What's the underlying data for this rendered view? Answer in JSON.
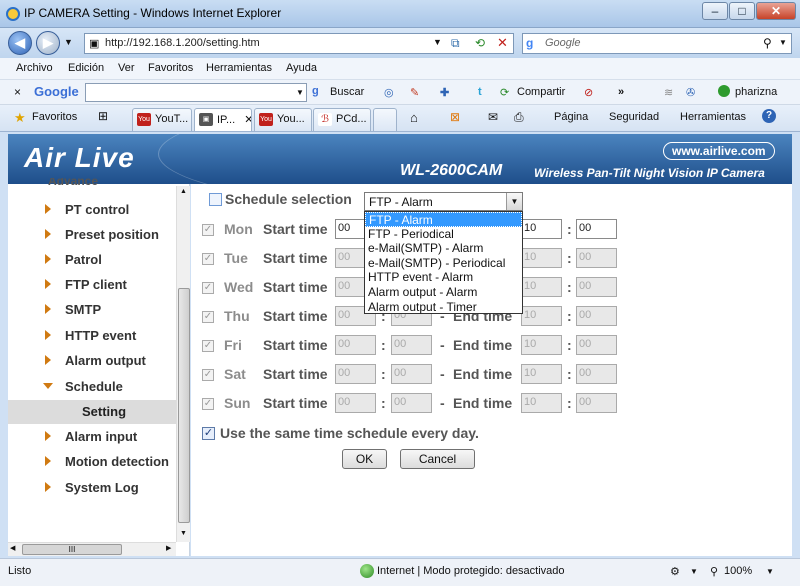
{
  "window": {
    "title": "IP CAMERA Setting - Windows Internet Explorer",
    "minimize": "–",
    "maximize": "□",
    "close": "✕"
  },
  "address_bar": {
    "url": "http://192.168.1.200/setting.htm",
    "search_placeholder": "Google"
  },
  "menu": [
    "Archivo",
    "Edición",
    "Ver",
    "Favoritos",
    "Herramientas",
    "Ayuda"
  ],
  "google_toolbar": {
    "label": "Google",
    "buscar": "Buscar",
    "compartir": "Compartir",
    "user": "pharizna"
  },
  "favorites_bar": {
    "favorites": "Favoritos",
    "tabs": [
      "YouT...",
      "IP...",
      "You...",
      "PCd..."
    ],
    "pagina": "Página",
    "seguridad": "Seguridad",
    "herramientas": "Herramientas"
  },
  "banner": {
    "logo": "Air Live",
    "website": "www.airlive.com",
    "model": "WL-2600CAM",
    "description": "Wireless Pan-Tilt Night Vision IP Camera"
  },
  "sidebar": {
    "partial_top": "Advance",
    "items": [
      {
        "label": "PT control"
      },
      {
        "label": "Preset position"
      },
      {
        "label": "Patrol"
      },
      {
        "label": "FTP client"
      },
      {
        "label": "SMTP"
      },
      {
        "label": "HTTP event"
      },
      {
        "label": "Alarm output"
      },
      {
        "label": "Schedule"
      },
      {
        "label": "Setting"
      },
      {
        "label": "Alarm input"
      },
      {
        "label": "Motion detection"
      },
      {
        "label": "System Log"
      }
    ],
    "hscroll_grip": "III"
  },
  "schedule": {
    "selection_label": "Schedule selection",
    "selected": "FTP - Alarm",
    "options": [
      "FTP - Alarm",
      "FTP - Periodical",
      "e-Mail(SMTP) - Alarm",
      "e-Mail(SMTP) - Periodical",
      "HTTP event - Alarm",
      "Alarm output - Alarm",
      "Alarm output - Timer"
    ],
    "start_label": "Start time",
    "end_label": "End time",
    "days": [
      {
        "day": "Mon",
        "start_h": "00",
        "start_m": "00",
        "end_h": "10",
        "end_m": "00"
      },
      {
        "day": "Tue",
        "start_h": "00",
        "start_m": "00",
        "end_h": "10",
        "end_m": "00"
      },
      {
        "day": "Wed",
        "start_h": "00",
        "start_m": "00",
        "end_h": "10",
        "end_m": "00"
      },
      {
        "day": "Thu",
        "start_h": "00",
        "start_m": "00",
        "end_h": "10",
        "end_m": "00"
      },
      {
        "day": "Fri",
        "start_h": "00",
        "start_m": "00",
        "end_h": "10",
        "end_m": "00"
      },
      {
        "day": "Sat",
        "start_h": "00",
        "start_m": "00",
        "end_h": "10",
        "end_m": "00"
      },
      {
        "day": "Sun",
        "start_h": "00",
        "start_m": "00",
        "end_h": "10",
        "end_m": "00"
      }
    ],
    "same_time_label": "Use the same time schedule every day.",
    "ok": "OK",
    "cancel": "Cancel"
  },
  "status": {
    "left": "Listo",
    "zone": "Internet | Modo protegido: desactivado",
    "zoom": "100%"
  }
}
